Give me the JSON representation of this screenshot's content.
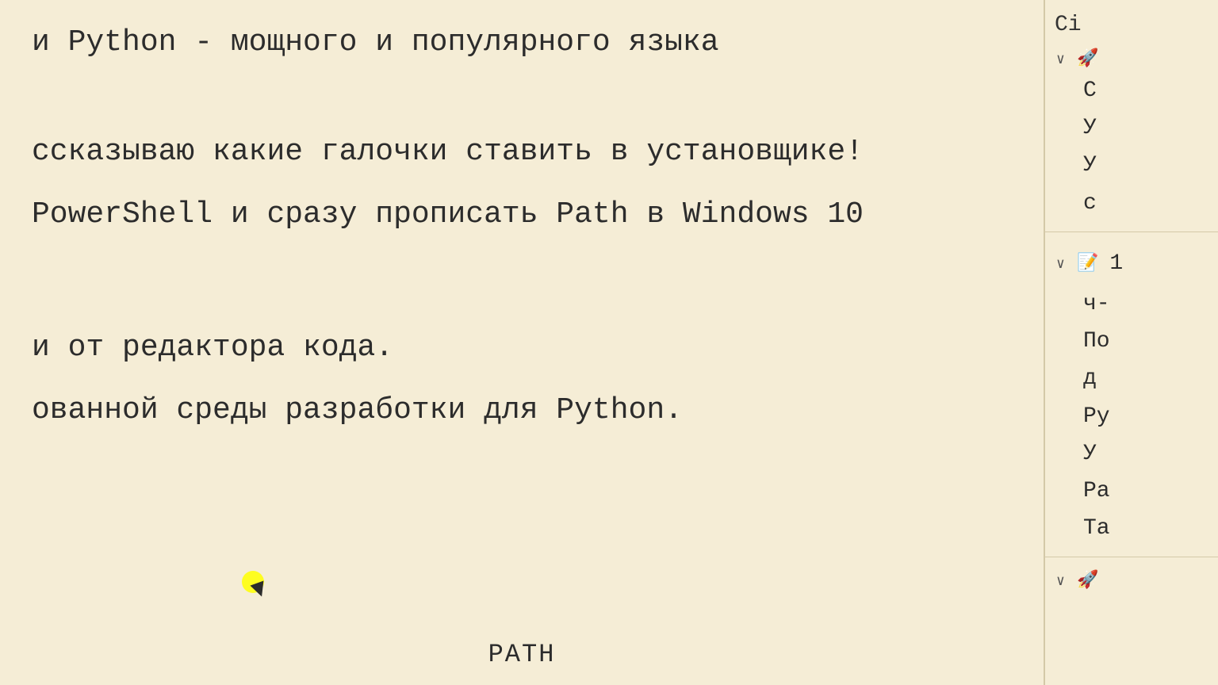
{
  "main": {
    "lines": [
      {
        "id": "line1",
        "text": "и Python - мощного и популярного языка"
      },
      {
        "id": "line2",
        "text": ""
      },
      {
        "id": "line3",
        "text": "ссказываю какие галочки ставить в установщике!"
      },
      {
        "id": "line4",
        "text": "PowerShell и сразу прописать Path в Windows 10"
      },
      {
        "id": "line5",
        "text": ""
      },
      {
        "id": "line6",
        "text": ""
      },
      {
        "id": "line7",
        "text": "и от редактора кода."
      },
      {
        "id": "line8",
        "text": "ованной среды разработки для Python."
      }
    ],
    "bottom_text": "PATH"
  },
  "sidebar": {
    "top_label": "Ci",
    "sections": [
      {
        "id": "section1",
        "chevron": "∨",
        "icon": "🚀",
        "lines": [
          "С"
        ]
      },
      {
        "id": "section1sub",
        "lines": [
          "У",
          "У",
          "с"
        ]
      },
      {
        "id": "section2",
        "chevron": "∨",
        "icon": "📝",
        "lines": [
          "1"
        ]
      },
      {
        "id": "section2sub",
        "lines": [
          "ч-",
          "По",
          "д",
          "Ру",
          "У",
          "Pa",
          "Та"
        ]
      },
      {
        "id": "section3",
        "chevron": "∨",
        "icon": "🚀",
        "lines": []
      }
    ]
  }
}
